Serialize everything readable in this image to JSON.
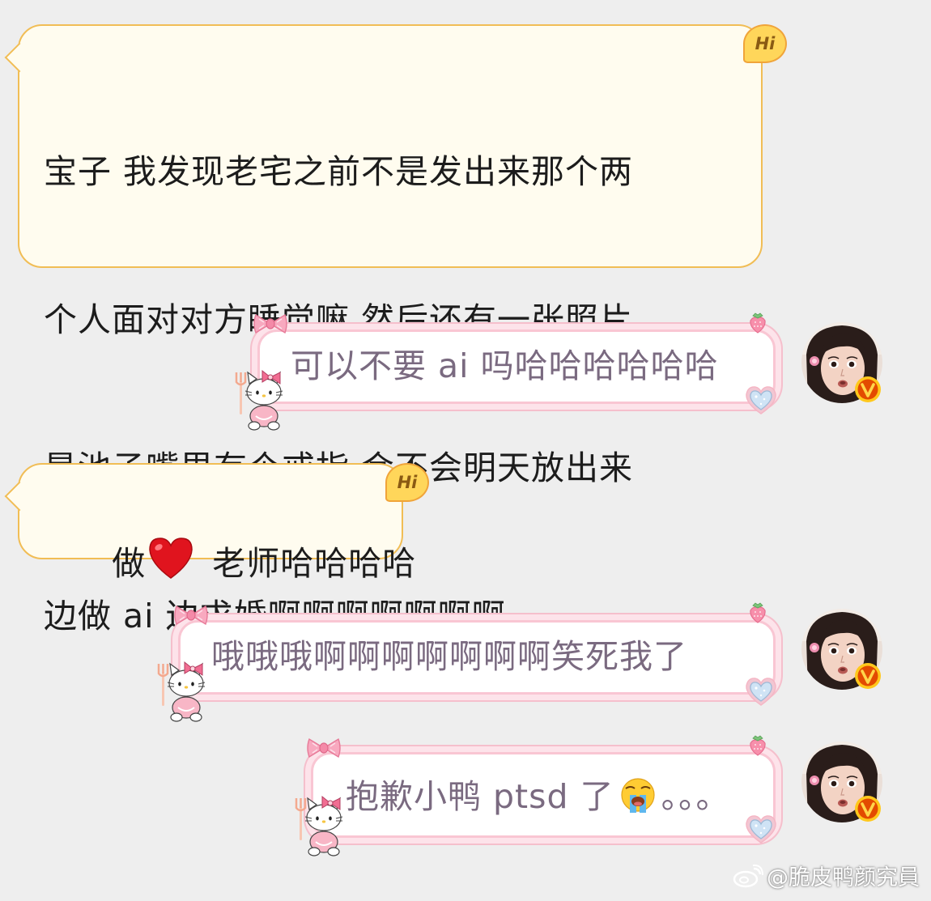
{
  "messages": [
    {
      "side": "incoming",
      "lines": [
        "宝子 我发现老宅之前不是发出来那个两",
        "个人面对对方睡觉嘛 然后还有一张照片",
        "是池子嘴里有个戒指 会不会明天放出来",
        "边做 ai 边求婚啊啊啊啊啊啊啊"
      ],
      "badge": "Hi"
    },
    {
      "side": "outgoing",
      "text": "可以不要 ai 吗哈哈哈哈哈哈"
    },
    {
      "side": "incoming",
      "text_before": "做",
      "emoji": "red-heart",
      "text_after": " 老师哈哈哈哈",
      "badge": "Hi"
    },
    {
      "side": "outgoing",
      "text": "哦哦哦啊啊啊啊啊啊啊笑死我了"
    },
    {
      "side": "outgoing",
      "text_before": "抱歉小鸭 ptsd 了",
      "emoji": "loudly-crying-face",
      "text_after": "。。。"
    }
  ],
  "watermark": {
    "icon": "weibo-icon",
    "text": "@脆皮鸭颜究員"
  },
  "colors": {
    "background": "#eeeeee",
    "incoming_bubble": "#fffcef",
    "incoming_border": "#f1bd55",
    "outgoing_bubble": "#ffffff",
    "outgoing_frame": "#f9c6d3",
    "outgoing_text": "#7a6a80",
    "verified_badge": "#e34b00"
  }
}
